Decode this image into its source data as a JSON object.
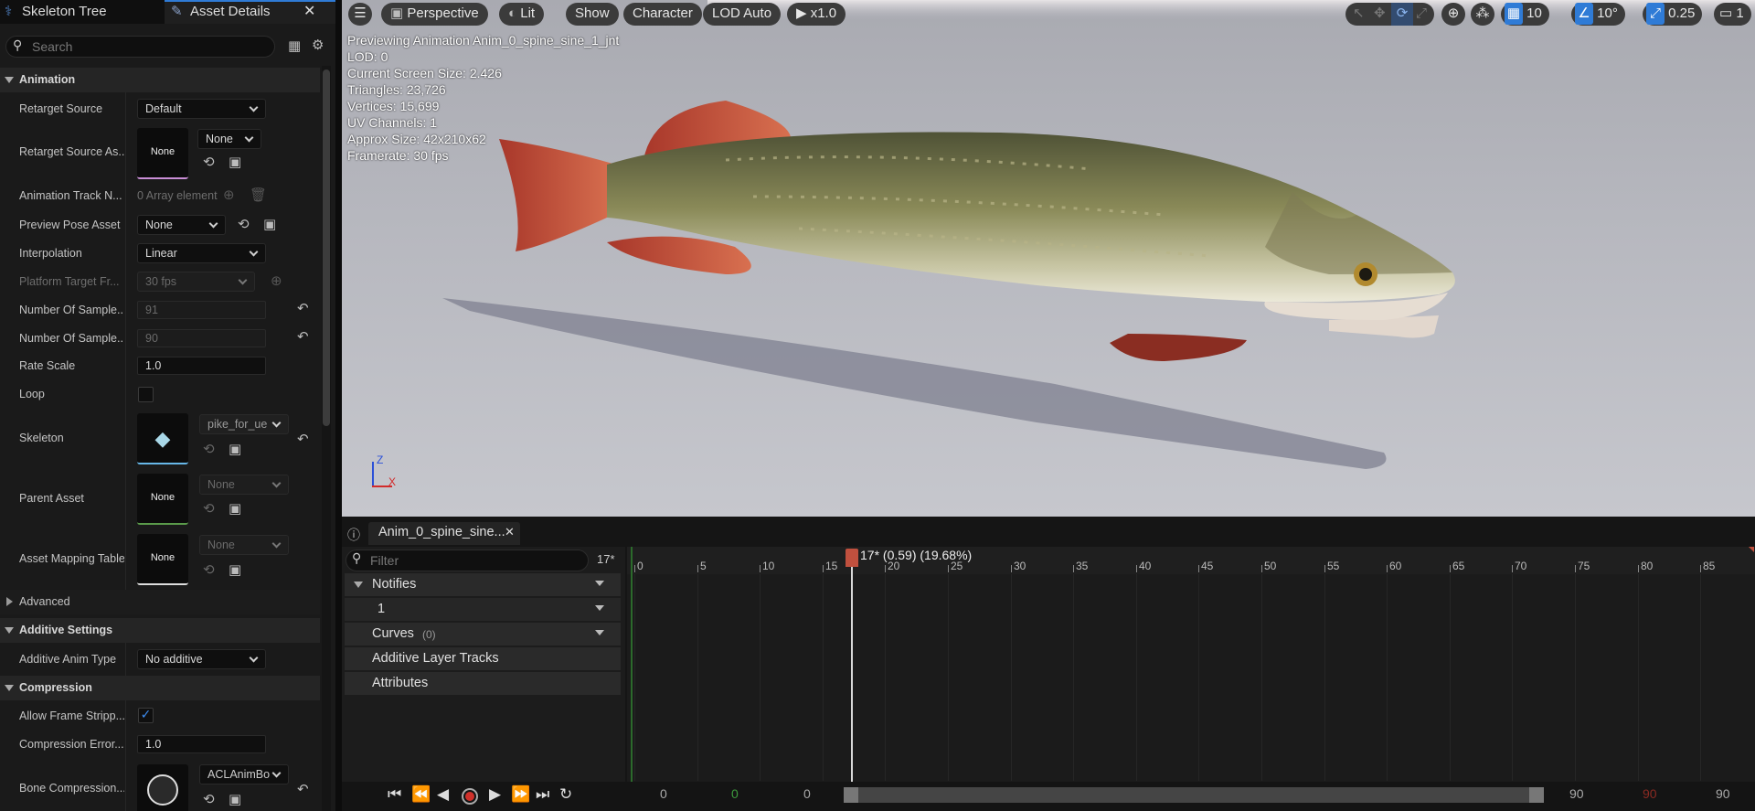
{
  "left_panel": {
    "tabs": [
      {
        "label": "Skeleton Tree"
      },
      {
        "label": "Asset Details"
      }
    ],
    "search_placeholder": "Search",
    "sections": {
      "animation": "Animation",
      "advanced": "Advanced",
      "additive": "Additive Settings",
      "compression": "Compression"
    },
    "props": {
      "retarget_source": {
        "label": "Retarget Source",
        "value": "Default"
      },
      "retarget_source_asset": {
        "label": "Retarget Source As...",
        "thumb": "None",
        "value": "None"
      },
      "animation_track": {
        "label": "Animation Track N...",
        "value": "0 Array element"
      },
      "preview_pose": {
        "label": "Preview Pose Asset",
        "value": "None"
      },
      "interpolation": {
        "label": "Interpolation",
        "value": "Linear"
      },
      "platform_target": {
        "label": "Platform Target Fr...",
        "value": "30 fps"
      },
      "num_samples_1": {
        "label": "Number Of Sample...",
        "value": "91"
      },
      "num_samples_2": {
        "label": "Number Of Sample...",
        "value": "90"
      },
      "rate_scale": {
        "label": "Rate Scale",
        "value": "1.0"
      },
      "loop": {
        "label": "Loop",
        "checked": false
      },
      "skeleton": {
        "label": "Skeleton",
        "value": "pike_for_ue"
      },
      "parent_asset": {
        "label": "Parent Asset",
        "thumb": "None",
        "value": "None"
      },
      "asset_mapping": {
        "label": "Asset Mapping Table",
        "thumb": "None",
        "value": "None"
      },
      "additive_anim_type": {
        "label": "Additive Anim Type",
        "value": "No additive"
      },
      "allow_frame_strip": {
        "label": "Allow Frame Stripp...",
        "checked": true
      },
      "compression_error": {
        "label": "Compression Error...",
        "value": "1.0"
      },
      "bone_compression": {
        "label": "Bone Compression...",
        "value": "ACLAnimBo"
      }
    }
  },
  "viewport": {
    "toolbar": {
      "perspective": "Perspective",
      "lit": "Lit",
      "show": "Show",
      "character": "Character",
      "lod": "LOD Auto",
      "play_speed": "x1.0",
      "grid_snap": "10",
      "angle_snap": "10°",
      "scale_snap": "0.25",
      "camera_speed": "1"
    },
    "stats": [
      "Previewing Animation Anim_0_spine_sine_1_jnt",
      "LOD: 0",
      "Current Screen Size: 2.426",
      "Triangles: 23,726",
      "Vertices: 15,699",
      "UV Channels: 1",
      "Approx Size: 42x210x62",
      "Framerate: 30 fps"
    ],
    "axis": {
      "z": "Z",
      "x": "X"
    }
  },
  "sequencer": {
    "tab_label": "Anim_0_spine_sine...",
    "filter_placeholder": "Filter",
    "current_frame": "17*",
    "playhead_label": "17* (0.59) (19.68%)",
    "tracks": {
      "notifies": "Notifies",
      "notify_1": "1",
      "curves": "Curves",
      "curves_count": "(0)",
      "additive_layer": "Additive Layer Tracks",
      "attributes": "Attributes"
    },
    "ticks": [
      "0",
      "5",
      "10",
      "15",
      "20",
      "25",
      "30",
      "35",
      "40",
      "45",
      "50",
      "55",
      "60",
      "65",
      "70",
      "75",
      "80",
      "85"
    ],
    "bottom": {
      "start": "0",
      "green": "0",
      "view_start": "0",
      "view_end": "90",
      "red": "90",
      "end": "90"
    }
  },
  "colors": {
    "accent": "#2f7bd6",
    "playhead": "#c0503e",
    "panel": "#1a1a1a"
  }
}
